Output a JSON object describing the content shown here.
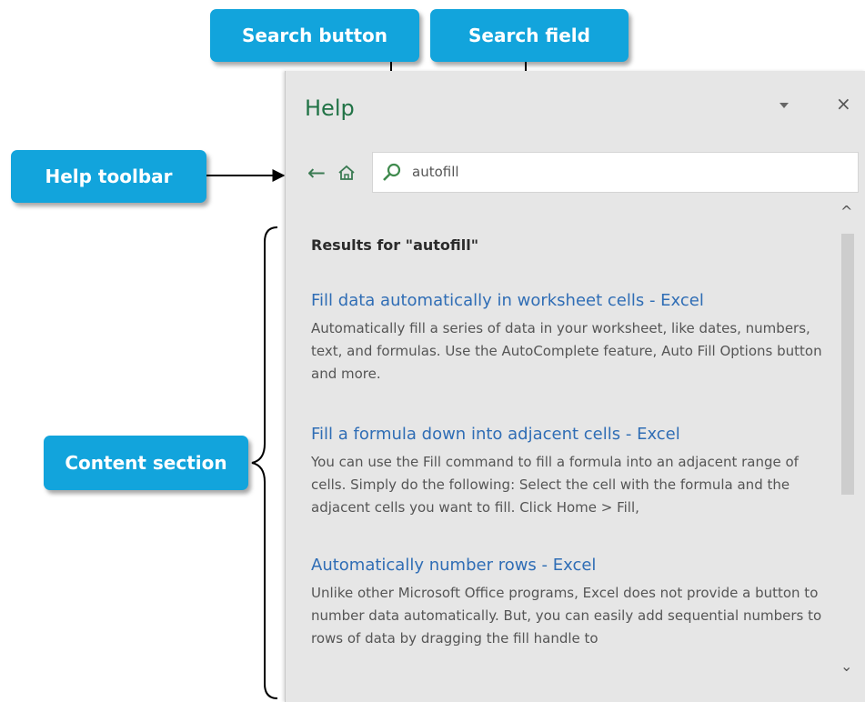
{
  "callouts": {
    "search_button": "Search button",
    "search_field": "Search field",
    "help_toolbar": "Help toolbar",
    "content_section": "Content section"
  },
  "pane": {
    "title": "Help",
    "close_glyph": "×"
  },
  "toolbar": {
    "back_glyph": "←",
    "back_icon": "back-arrow-icon",
    "home_icon": "home-icon"
  },
  "search": {
    "icon": "search-icon",
    "value": "autofill"
  },
  "content": {
    "heading": "Results for \"autofill\"",
    "results": [
      {
        "title": "Fill data automatically in worksheet cells - Excel",
        "description": "Automatically fill a series of data in your worksheet, like dates, numbers, text, and formulas. Use the AutoComplete feature, Auto Fill Options button and more."
      },
      {
        "title": "Fill a formula down into adjacent cells - Excel",
        "description": "You can use the Fill command to fill a formula into an adjacent range of cells. Simply do the following: Select the cell with the formula and the adjacent cells you want to fill. Click Home > Fill,"
      },
      {
        "title": "Automatically number rows - Excel",
        "description": "Unlike other Microsoft Office programs, Excel does not provide a button to number data automatically. But, you can easily add sequential numbers to rows of data by dragging the fill handle to"
      }
    ]
  },
  "scrollbar": {
    "up_glyph": "^",
    "down_glyph": "⌄"
  },
  "colors": {
    "callout": "#12a4dc",
    "pane_background": "#e6e6e6",
    "title_green": "#217346",
    "link_blue": "#2f6db5"
  }
}
